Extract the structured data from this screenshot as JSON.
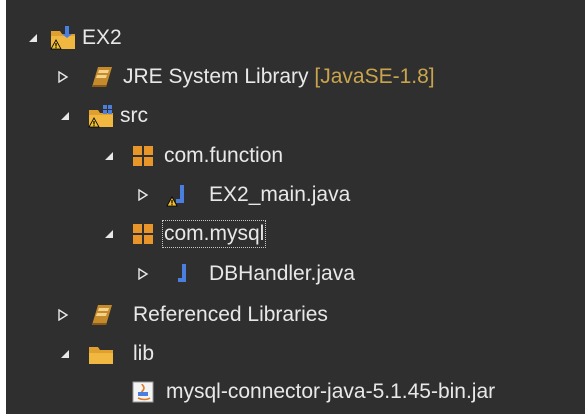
{
  "tree": {
    "items": [
      {
        "label": "EX2",
        "qualifier": "",
        "icon": "java-project-warning-icon",
        "state": "expanded"
      },
      {
        "label": "JRE System Library ",
        "qualifier": "[JavaSE-1.8]",
        "icon": "library-icon",
        "state": "collapsed"
      },
      {
        "label": "src",
        "qualifier": "",
        "icon": "source-folder-warning-icon",
        "state": "expanded"
      },
      {
        "label": "com.function",
        "qualifier": "",
        "icon": "package-icon",
        "state": "expanded"
      },
      {
        "label": "EX2_main.java",
        "qualifier": "",
        "icon": "java-file-warning-icon",
        "state": "collapsed"
      },
      {
        "label": "com.mysql",
        "qualifier": "",
        "icon": "package-icon",
        "state": "expanded",
        "selected": true
      },
      {
        "label": "DBHandler.java",
        "qualifier": "",
        "icon": "java-file-icon",
        "state": "collapsed"
      },
      {
        "label": "Referenced Libraries",
        "qualifier": "",
        "icon": "library-icon",
        "state": "collapsed"
      },
      {
        "label": "lib",
        "qualifier": "",
        "icon": "folder-icon",
        "state": "expanded"
      },
      {
        "label": "mysql-connector-java-5.1.45-bin.jar",
        "qualifier": "",
        "icon": "jar-file-icon",
        "state": "leaf"
      }
    ]
  },
  "colors": {
    "background": "#2f2f2f",
    "text": "#e8e8e8",
    "qualifier": "#c9a44c",
    "folder": "#e0a030",
    "package": "#e8962a",
    "java": "#4a7fe0",
    "warning": "#f2c12e"
  }
}
